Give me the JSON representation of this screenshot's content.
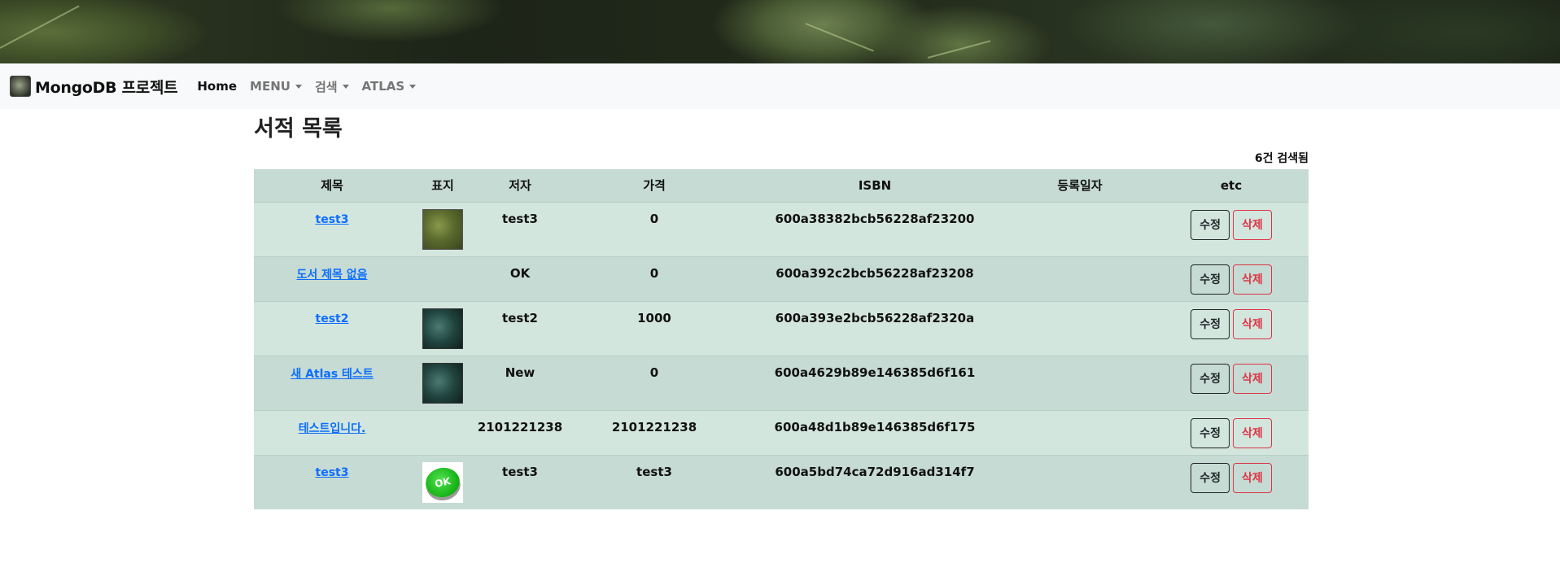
{
  "navbar": {
    "brand": "MongoDB 프로젝트",
    "items": [
      {
        "label": "Home",
        "active": true,
        "dropdown": false
      },
      {
        "label": "MENU",
        "active": false,
        "dropdown": true
      },
      {
        "label": "검색",
        "active": false,
        "dropdown": true
      },
      {
        "label": "ATLAS",
        "active": false,
        "dropdown": true
      }
    ]
  },
  "page": {
    "title": "서적 목록",
    "count": "6건 검색됨"
  },
  "table": {
    "headers": [
      "제목",
      "표지",
      "저자",
      "가격",
      "ISBN",
      "등록일자",
      "etc"
    ],
    "edit_label": "수정",
    "delete_label": "삭제",
    "rows": [
      {
        "title": "test3",
        "cover": "leaf",
        "author": "test3",
        "price": "0",
        "isbn": "600a38382bcb56228af23200",
        "date": ""
      },
      {
        "title": "도서 제목 없음",
        "cover": "",
        "author": "OK",
        "price": "0",
        "isbn": "600a392c2bcb56228af23208",
        "date": ""
      },
      {
        "title": "test2",
        "cover": "dark",
        "author": "test2",
        "price": "1000",
        "isbn": "600a393e2bcb56228af2320a",
        "date": ""
      },
      {
        "title": "새 Atlas 테스트",
        "cover": "dark",
        "author": "New",
        "price": "0",
        "isbn": "600a4629b89e146385d6f161",
        "date": ""
      },
      {
        "title": "테스트입니다.",
        "cover": "",
        "author": "2101221238",
        "price": "2101221238",
        "isbn": "600a48d1b89e146385d6f175",
        "date": ""
      },
      {
        "title": "test3",
        "cover": "ok",
        "cover_text": "OK",
        "author": "test3",
        "price": "test3",
        "isbn": "600a5bd74ca72d916ad314f7",
        "date": ""
      }
    ]
  },
  "colors": {
    "row_light": "#d3e6de",
    "row_dark": "#c6dbd3",
    "link": "#0d6efd",
    "danger": "#dc3545"
  }
}
